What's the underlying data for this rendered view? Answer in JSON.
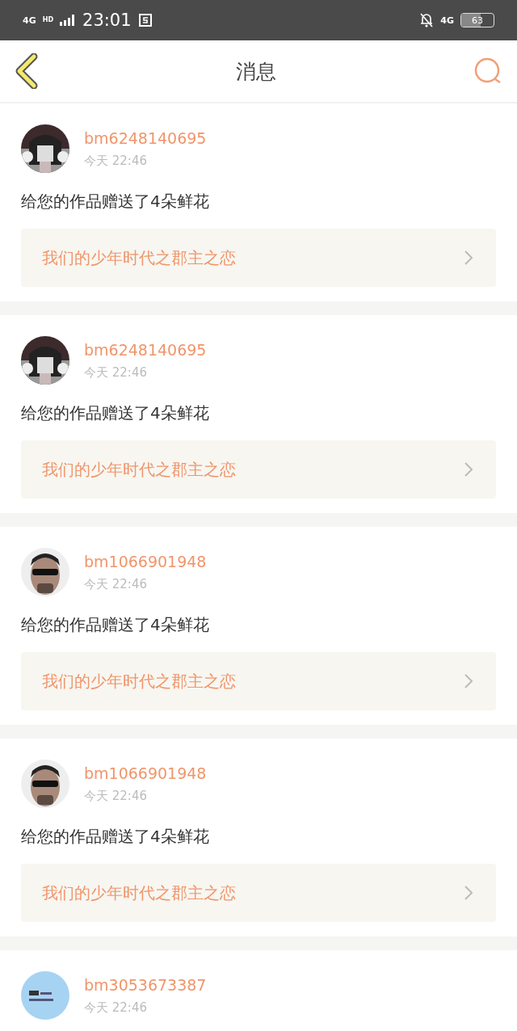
{
  "status_bar": {
    "network": "4G",
    "network_badge": "HD",
    "time": "23:01",
    "right_network": "4G",
    "battery": "63"
  },
  "header": {
    "title": "消息"
  },
  "messages": [
    {
      "user": "bm6248140695",
      "time": "今天 22:46",
      "text": "给您的作品赠送了4朵鲜花",
      "work": "我们的少年时代之郡主之恋"
    },
    {
      "user": "bm6248140695",
      "time": "今天 22:46",
      "text": "给您的作品赠送了4朵鲜花",
      "work": "我们的少年时代之郡主之恋"
    },
    {
      "user": "bm1066901948",
      "time": "今天 22:46",
      "text": "给您的作品赠送了4朵鲜花",
      "work": "我们的少年时代之郡主之恋"
    },
    {
      "user": "bm1066901948",
      "time": "今天 22:46",
      "text": "给您的作品赠送了4朵鲜花",
      "work": "我们的少年时代之郡主之恋"
    },
    {
      "user": "bm3053673387",
      "time": "今天 22:46"
    }
  ]
}
